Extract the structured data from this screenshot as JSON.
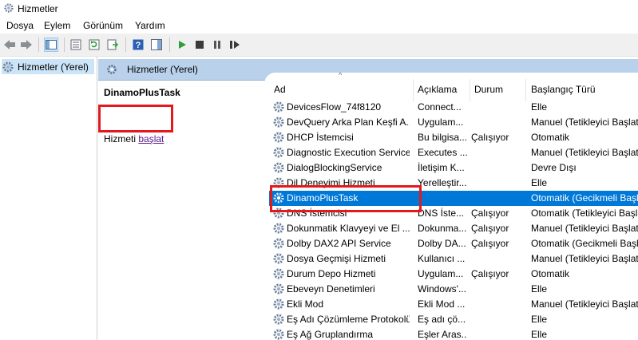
{
  "window": {
    "title": "Hizmetler"
  },
  "menu": [
    "Dosya",
    "Eylem",
    "Görünüm",
    "Yardım"
  ],
  "toolbar": {
    "buttons": [
      "back-icon",
      "forward-icon",
      "show-hide-tree-icon",
      "properties-icon",
      "refresh-icon",
      "export-list-icon",
      "help-icon",
      "action-pane-icon",
      "start-service-icon",
      "stop-service-icon",
      "pause-service-icon",
      "restart-service-icon"
    ],
    "play_color": "#2e9e3a"
  },
  "left_tree": {
    "item": "Hizmetler (Yerel)"
  },
  "right_header": {
    "title": "Hizmetler (Yerel)"
  },
  "description": {
    "service_name": "DinamoPlusTask",
    "start_prefix": "Hizmeti ",
    "start_link": "başlat"
  },
  "columns": [
    "Ad",
    "Açıklama",
    "Durum",
    "Başlangıç Türü"
  ],
  "services": [
    {
      "name": "DevicesFlow_74f8120",
      "desc": "Connect...",
      "status": "",
      "type": "Elle"
    },
    {
      "name": "DevQuery Arka Plan Keşfi A...",
      "desc": "Uygulam...",
      "status": "",
      "type": "Manuel (Tetikleyici Başlat"
    },
    {
      "name": "DHCP İstemcisi",
      "desc": "Bu bilgisa...",
      "status": "Çalışıyor",
      "type": "Otomatik"
    },
    {
      "name": "Diagnostic Execution Service",
      "desc": "Executes ...",
      "status": "",
      "type": "Manuel (Tetikleyici Başlat"
    },
    {
      "name": "DialogBlockingService",
      "desc": "İletişim K...",
      "status": "",
      "type": "Devre Dışı"
    },
    {
      "name": "Dil Deneyimi Hizmeti",
      "desc": "Yerelleştir...",
      "status": "",
      "type": "Elle"
    },
    {
      "name": "DinamoPlusTask",
      "desc": "",
      "status": "",
      "type": "Otomatik (Gecikmeli Başl",
      "selected": true
    },
    {
      "name": "DNS İstemcisi",
      "desc": "DNS İste...",
      "status": "Çalışıyor",
      "type": "Otomatik (Tetikleyici Başla"
    },
    {
      "name": "Dokunmatik Klavyeyi ve El ...",
      "desc": "Dokunma...",
      "status": "Çalışıyor",
      "type": "Manuel (Tetikleyici Başlat"
    },
    {
      "name": "Dolby DAX2 API Service",
      "desc": "Dolby DA...",
      "status": "Çalışıyor",
      "type": "Otomatik (Gecikmeli Başl"
    },
    {
      "name": "Dosya Geçmişi Hizmeti",
      "desc": "Kullanıcı ...",
      "status": "",
      "type": "Manuel (Tetikleyici Başlat"
    },
    {
      "name": "Durum Depo Hizmeti",
      "desc": "Uygulam...",
      "status": "Çalışıyor",
      "type": "Otomatik"
    },
    {
      "name": "Ebeveyn Denetimleri",
      "desc": "Windows'...",
      "status": "",
      "type": "Elle"
    },
    {
      "name": "Ekli Mod",
      "desc": "Ekli Mod ...",
      "status": "",
      "type": "Manuel (Tetikleyici Başlat"
    },
    {
      "name": "Eş Adı Çözümleme Protokolü",
      "desc": "Eş adı çö...",
      "status": "",
      "type": "Elle"
    },
    {
      "name": "Eş Ağ Gruplandırma",
      "desc": "Eşler Aras...",
      "status": "",
      "type": "Elle"
    }
  ],
  "colors": {
    "selection": "#0078d7",
    "highlight_box": "#e3191d",
    "header_band": "#b9d1ea",
    "tree_selected": "#cce4f7"
  }
}
